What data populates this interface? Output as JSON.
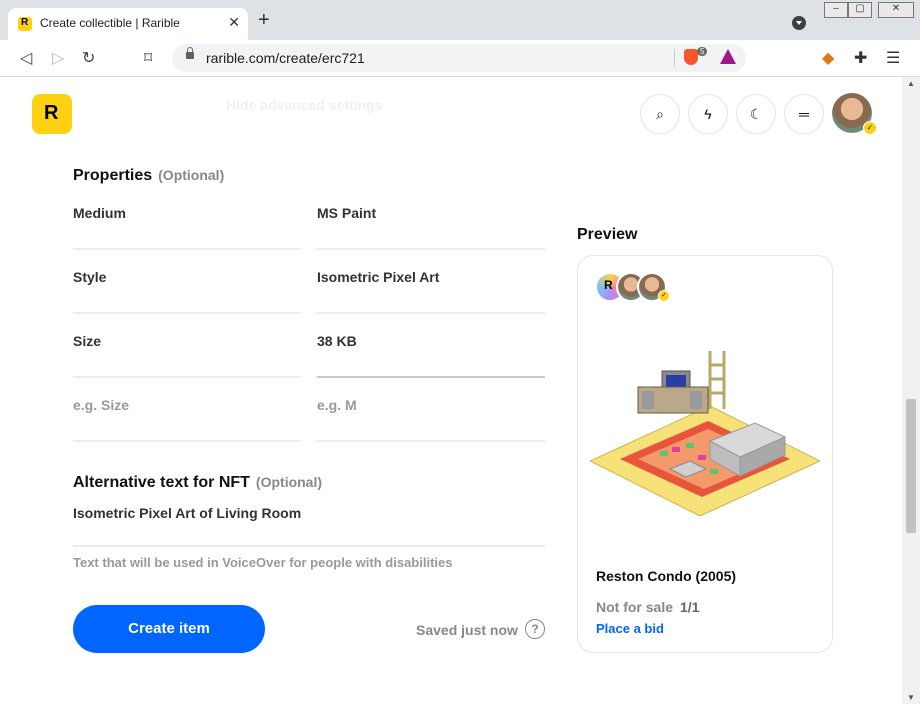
{
  "browser": {
    "tab_title": "Create collectible | Rarible",
    "url": "rarible.com/create/erc721",
    "brave_badge": "5"
  },
  "header": {
    "logo_letter": "R",
    "ghost_text": "Hide advanced settings"
  },
  "properties": {
    "title": "Properties",
    "optional": "(Optional)",
    "rows": [
      {
        "key": "Medium",
        "value": "MS Paint"
      },
      {
        "key": "Style",
        "value": "Isometric Pixel Art"
      },
      {
        "key": "Size",
        "value": "38 KB"
      }
    ],
    "placeholder_key": "e.g. Size",
    "placeholder_value": "e.g. M"
  },
  "alt_text": {
    "title": "Alternative text for NFT",
    "optional": "(Optional)",
    "value": "Isometric Pixel Art of Living Room",
    "helper": "Text that will be used in VoiceOver for people with disabilities"
  },
  "actions": {
    "create_label": "Create item",
    "saved_label": "Saved just now",
    "help_label": "?"
  },
  "preview": {
    "title": "Preview",
    "mini_logo": "R",
    "name": "Reston Condo (2005)",
    "sale_status": "Not for sale",
    "edition": "1/1",
    "bid_label": "Place a bid"
  },
  "colors": {
    "accent": "#0066ff",
    "brand": "#fed113"
  }
}
